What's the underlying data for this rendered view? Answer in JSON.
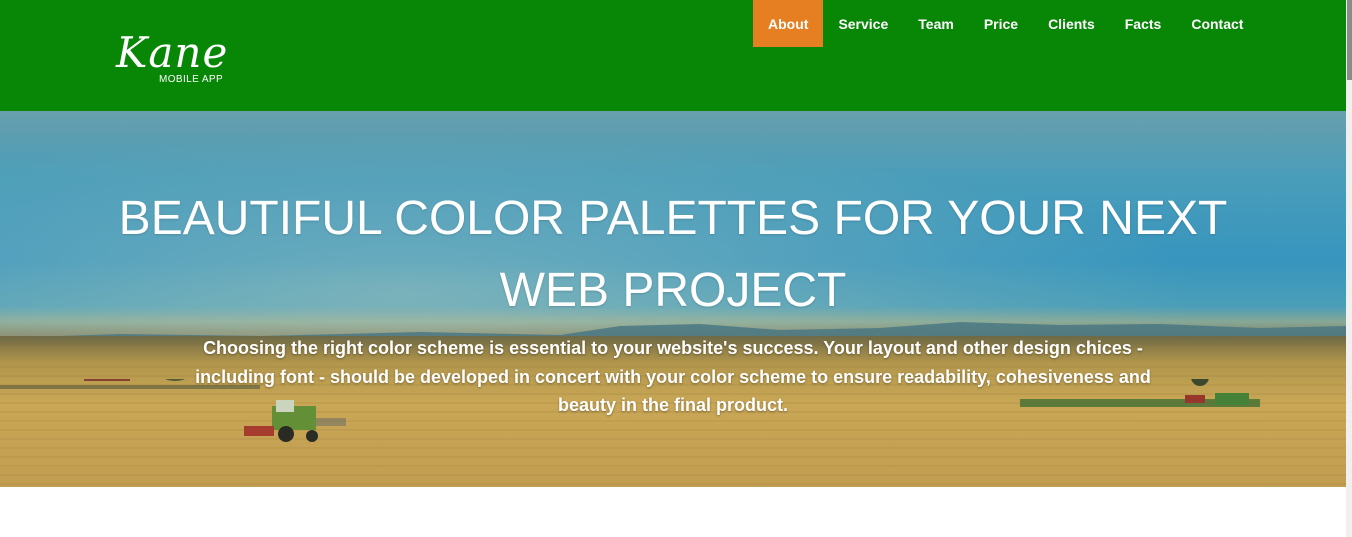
{
  "brand": {
    "logo_script": "Kane",
    "logo_subtitle": "MOBILE APP"
  },
  "nav": {
    "items": [
      {
        "label": "About",
        "active": true
      },
      {
        "label": "Service",
        "active": false
      },
      {
        "label": "Team",
        "active": false
      },
      {
        "label": "Price",
        "active": false
      },
      {
        "label": "Clients",
        "active": false
      },
      {
        "label": "Facts",
        "active": false
      },
      {
        "label": "Contact",
        "active": false
      }
    ]
  },
  "hero": {
    "title": "BEAUTIFUL COLOR PALETTES FOR YOUR NEXT WEB PROJECT",
    "text": "Choosing the right color scheme is essential to your website's success. Your layout and other design chices - including font - should be developed in concert with your color scheme to ensure readability, cohesiveness and beauty in the final product."
  },
  "colors": {
    "header_bg": "#088606",
    "nav_active_bg": "#e67e22",
    "text": "#ffffff"
  }
}
